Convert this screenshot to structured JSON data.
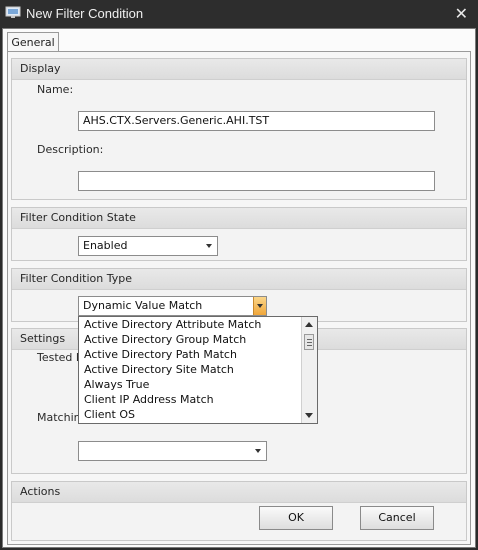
{
  "window": {
    "title": "New Filter Condition",
    "close_glyph": "✕",
    "icon": "monitor-icon"
  },
  "tabs": [
    {
      "label": "General",
      "selected": true
    }
  ],
  "display": {
    "header": "Display",
    "name_label": "Name:",
    "name_value": "AHS.CTX.Servers.Generic.AHI.TST",
    "description_label": "Description:",
    "description_value": ""
  },
  "state": {
    "header": "Filter Condition State",
    "selected": "Enabled"
  },
  "type": {
    "header": "Filter Condition Type",
    "selected": "Dynamic Value Match",
    "options": [
      "Active Directory Attribute Match",
      "Active Directory Group Match",
      "Active Directory Path Match",
      "Active Directory Site Match",
      "Always True",
      "Client IP Address Match",
      "Client OS"
    ]
  },
  "settings": {
    "header": "Settings",
    "tested_label": "Tested D",
    "matching_label": "Matching",
    "matching_value": ""
  },
  "actions": {
    "header": "Actions",
    "ok": "OK",
    "cancel": "Cancel"
  },
  "colors": {
    "titlebar": "#2d2d2d",
    "active_combo_button": "#f0a63a"
  }
}
